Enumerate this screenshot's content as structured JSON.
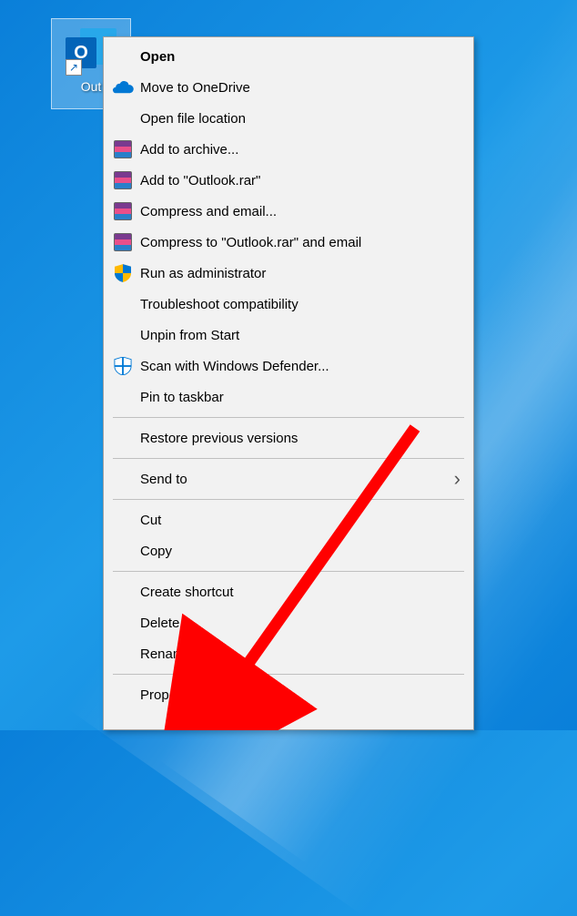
{
  "desktop": {
    "icon_letter": "O",
    "icon_label": "Out"
  },
  "menu": {
    "items": [
      {
        "id": "open",
        "label": "Open",
        "icon": null,
        "bold": true
      },
      {
        "id": "move-onedrive",
        "label": "Move to OneDrive",
        "icon": "onedrive"
      },
      {
        "id": "open-location",
        "label": "Open file location",
        "icon": null
      },
      {
        "id": "add-archive",
        "label": "Add to archive...",
        "icon": "winrar"
      },
      {
        "id": "add-outlook-rar",
        "label": "Add to \"Outlook.rar\"",
        "icon": "winrar"
      },
      {
        "id": "compress-email",
        "label": "Compress and email...",
        "icon": "winrar"
      },
      {
        "id": "compress-outlook-email",
        "label": "Compress to \"Outlook.rar\" and email",
        "icon": "winrar"
      },
      {
        "id": "run-admin",
        "label": "Run as administrator",
        "icon": "uac-shield"
      },
      {
        "id": "troubleshoot",
        "label": "Troubleshoot compatibility",
        "icon": null
      },
      {
        "id": "unpin-start",
        "label": "Unpin from Start",
        "icon": null
      },
      {
        "id": "scan-defender",
        "label": "Scan with Windows Defender...",
        "icon": "defender"
      },
      {
        "id": "pin-taskbar",
        "label": "Pin to taskbar",
        "icon": null
      },
      {
        "sep": true
      },
      {
        "id": "restore-versions",
        "label": "Restore previous versions",
        "icon": null
      },
      {
        "sep": true
      },
      {
        "id": "send-to",
        "label": "Send to",
        "icon": null,
        "submenu": true
      },
      {
        "sep": true
      },
      {
        "id": "cut",
        "label": "Cut",
        "icon": null
      },
      {
        "id": "copy",
        "label": "Copy",
        "icon": null
      },
      {
        "sep": true
      },
      {
        "id": "create-shortcut",
        "label": "Create shortcut",
        "icon": null
      },
      {
        "id": "delete",
        "label": "Delete",
        "icon": null
      },
      {
        "id": "rename",
        "label": "Rename",
        "icon": null
      },
      {
        "sep": true
      },
      {
        "id": "properties",
        "label": "Properties",
        "icon": null
      }
    ]
  }
}
